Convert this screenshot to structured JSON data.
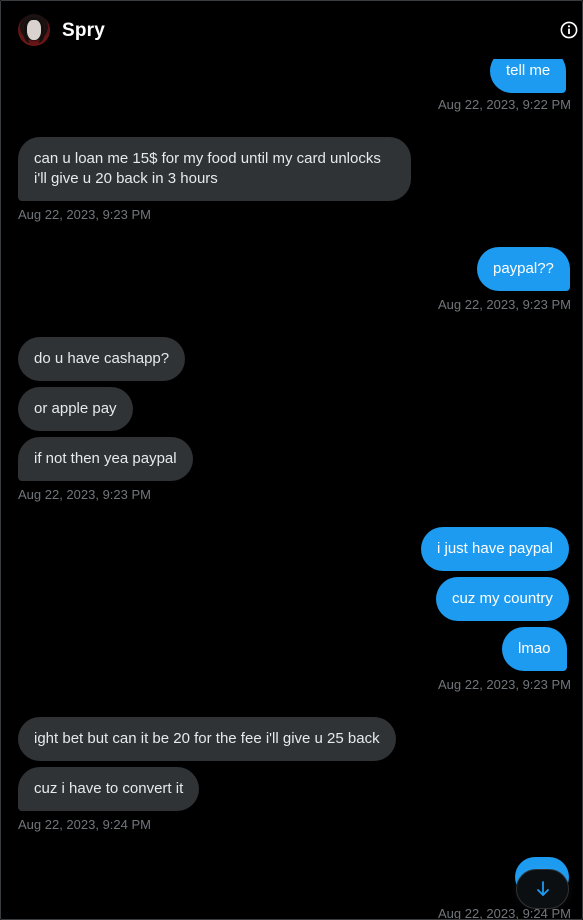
{
  "header": {
    "contact_name": "Spry"
  },
  "messages": [
    {
      "id": "m1",
      "side": "sent",
      "text": "tell me"
    },
    {
      "id": "t1",
      "timestamp": "Aug 22, 2023, 9:22 PM"
    },
    {
      "id": "m2",
      "side": "recv",
      "lines": [
        "can u loan me 15$ for my food until my card unlocks",
        "i'll give u 20 back in 3 hours"
      ]
    },
    {
      "id": "t2",
      "timestamp": "Aug 22, 2023, 9:23 PM"
    },
    {
      "id": "m3",
      "side": "sent",
      "text": "paypal??"
    },
    {
      "id": "t3",
      "timestamp": "Aug 22, 2023, 9:23 PM"
    },
    {
      "id": "m4",
      "side": "recv",
      "text": "do u have cashapp?"
    },
    {
      "id": "m5",
      "side": "recv",
      "text": "or apple pay"
    },
    {
      "id": "m6",
      "side": "recv",
      "text": "if not then yea paypal"
    },
    {
      "id": "t4",
      "timestamp": "Aug 22, 2023, 9:23 PM"
    },
    {
      "id": "m7",
      "side": "sent",
      "text": "i just have paypal"
    },
    {
      "id": "m8",
      "side": "sent",
      "text": "cuz my country"
    },
    {
      "id": "m9",
      "side": "sent",
      "text": "lmao"
    },
    {
      "id": "t5",
      "timestamp": "Aug 22, 2023, 9:23 PM"
    },
    {
      "id": "m10",
      "side": "recv",
      "text": "ight bet but can it be 20 for the fee i'll give u 25 back"
    },
    {
      "id": "m11",
      "side": "recv",
      "text": "cuz i have to convert it"
    },
    {
      "id": "t6",
      "timestamp": "Aug 22, 2023, 9:24 PM"
    },
    {
      "id": "t7",
      "timestamp": "Aug 22, 2023, 9:24 PM"
    }
  ],
  "icons": {
    "info": "info-icon",
    "scroll_down": "arrow-down-icon",
    "avatar": "avatar-image"
  },
  "colors": {
    "background": "#000000",
    "sent_bubble": "#1d9bf0",
    "received_bubble": "#2f3336",
    "timestamp": "#71767b",
    "text": "#ffffff"
  }
}
